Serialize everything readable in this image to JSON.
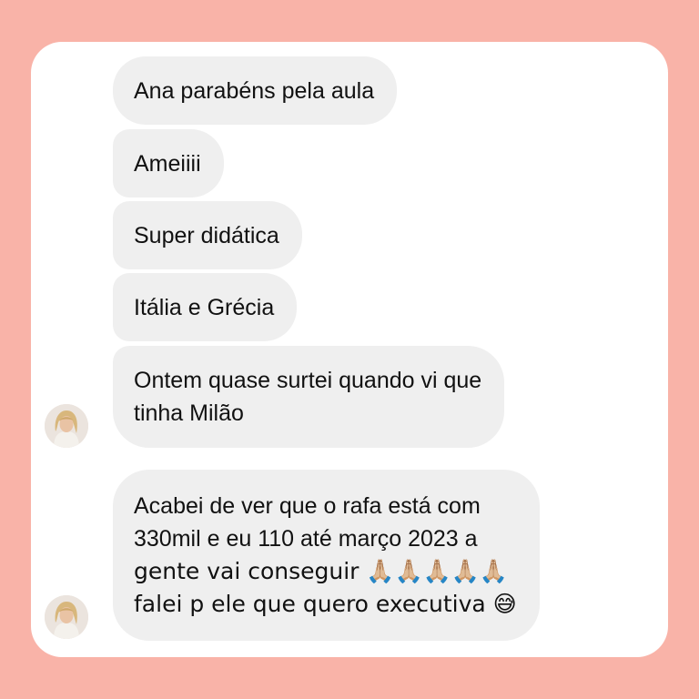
{
  "messages": [
    {
      "lines": [
        "Ana parabéns pela aula"
      ]
    },
    {
      "lines": [
        "Ameiiii"
      ]
    },
    {
      "lines": [
        "Super didática"
      ]
    },
    {
      "lines": [
        "Itália e Grécia"
      ]
    },
    {
      "lines": [
        "Ontem quase surtei quando vi que",
        "tinha Milão"
      ]
    },
    {
      "lines": [
        "Acabei de ver que o rafa está com",
        "330mil e eu 110 até março 2023 a",
        "gente vai conseguir 🙏🏼🙏🏼🙏🏼🙏🏼🙏🏼",
        "falei p ele que quero executiva 😅"
      ]
    }
  ],
  "colors": {
    "page_background": "#f9b3a8",
    "card_background": "#ffffff",
    "bubble_background": "#efefef",
    "text": "#111111"
  },
  "icons": {
    "sender_avatar": "avatar-woman-blonde"
  }
}
